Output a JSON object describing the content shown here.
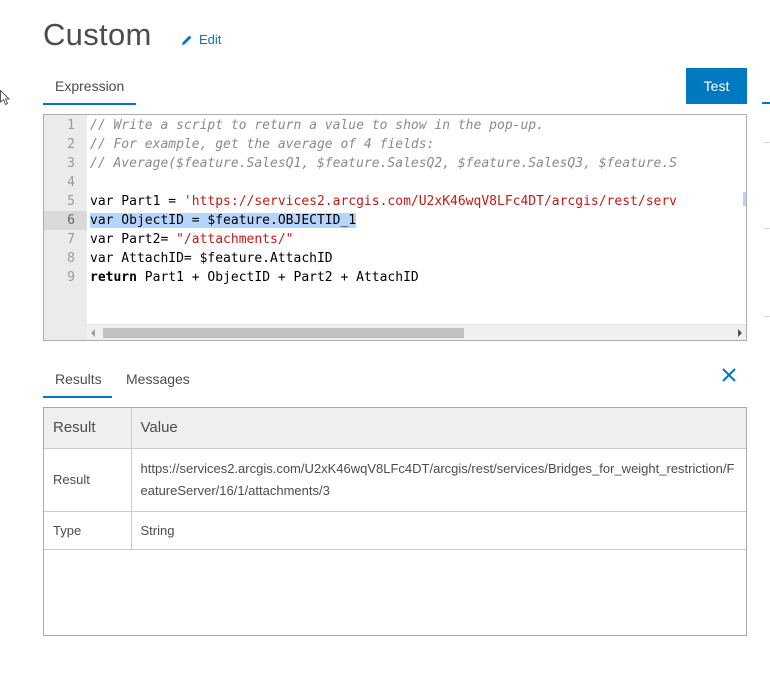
{
  "header": {
    "title": "Custom",
    "edit_label": "Edit"
  },
  "tabs": {
    "expression": "Expression",
    "test_button": "Test"
  },
  "editor": {
    "line_numbers": [
      "1",
      "2",
      "3",
      "4",
      "5",
      "6",
      "7",
      "8",
      "9"
    ],
    "active_line": "6",
    "lines": [
      "// Write a script to return a value to show in the pop-up.",
      "// For example, get the average of 4 fields:",
      "// Average($feature.SalesQ1, $feature.SalesQ2, $feature.SalesQ3, $feature.S",
      "",
      "var Part1 = 'https://services2.arcgis.com/U2xK46wqV8LFc4DT/arcgis/rest/serv",
      "var ObjectID = $feature.OBJECTID_1",
      "var Part2= \"/attachments/\"",
      "var AttachID= $feature.AttachID",
      "return Part1 + ObjectID + Part2 + AttachID"
    ],
    "tokens": {
      "l5_prefix": "var Part1 = ",
      "l5_string": "'https://services2.arcgis.com/U2xK46wqV8LFc4DT/arcgis/rest/serv",
      "l6": "var ObjectID = $feature.OBJECTID_1",
      "l7_prefix": "var Part2= ",
      "l7_string": "\"/attachments/\"",
      "l8": "var AttachID= $feature.AttachID",
      "l9_kw": "return",
      "l9_rest": " Part1 + ObjectID + Part2 + AttachID"
    }
  },
  "bottom_tabs": {
    "results": "Results",
    "messages": "Messages"
  },
  "results_table": {
    "headers": [
      "Result",
      "Value"
    ],
    "rows": [
      {
        "label": "Result",
        "value": "https://services2.arcgis.com/U2xK46wqV8LFc4DT/arcgis/rest/services/Bridges_for_weight_restriction/FeatureServer/16/1/attachments/3"
      },
      {
        "label": "Type",
        "value": "String"
      }
    ]
  },
  "colors": {
    "accent": "#0079c1",
    "string": "#c41a16",
    "comment": "#8a8a8a",
    "selection": "#b5d5ff"
  },
  "icons": {
    "edit": "pencil-icon",
    "close": "close-icon",
    "cursor": "mouse-pointer-icon"
  }
}
